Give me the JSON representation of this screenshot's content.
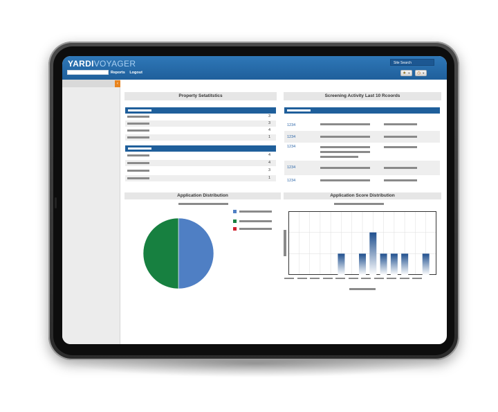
{
  "header": {
    "logo_main": "YARDI",
    "logo_sub": "VOYAGER",
    "site_search": "Site Search",
    "nav": [
      "Reports",
      "Logout"
    ],
    "favorites_icon": "star-icon",
    "history_icon": "clock-icon"
  },
  "sidebar": {
    "collapse_icon": "chevron-left-icon"
  },
  "stats": {
    "title": "Property Setatitstics",
    "group1": [
      "3",
      "3",
      "4",
      "1"
    ],
    "group2": [
      "4",
      "4",
      "3",
      "1"
    ]
  },
  "screening": {
    "title": "Screening Activity Last 10 Rcoords",
    "ids": [
      "1234",
      "1234",
      "1234",
      "1234",
      "1234"
    ]
  },
  "app_dist": {
    "title": "Application Distribution"
  },
  "score_dist": {
    "title": "Application Score Distribution"
  },
  "colors": {
    "brand_blue": "#1f5f9b",
    "pie_blue": "#4f7fc4",
    "pie_green": "#178040",
    "legend_red": "#d0202e",
    "accent_orange": "#e8841e"
  },
  "chart_data": [
    {
      "type": "pie",
      "title": "Application Distribution",
      "values": [
        50,
        50,
        0
      ],
      "colors": [
        "#4f7fc4",
        "#178040",
        "#d0202e"
      ]
    },
    {
      "type": "bar",
      "title": "Application Score Distribution",
      "categories": [
        "",
        "",
        "",
        "",
        "",
        "",
        "",
        "",
        "",
        "",
        "",
        ""
      ],
      "values": [
        0,
        0,
        0,
        0,
        1,
        0,
        1,
        2,
        1,
        1,
        1,
        0,
        1
      ],
      "ylim": [
        0,
        3
      ],
      "grid": true
    }
  ]
}
